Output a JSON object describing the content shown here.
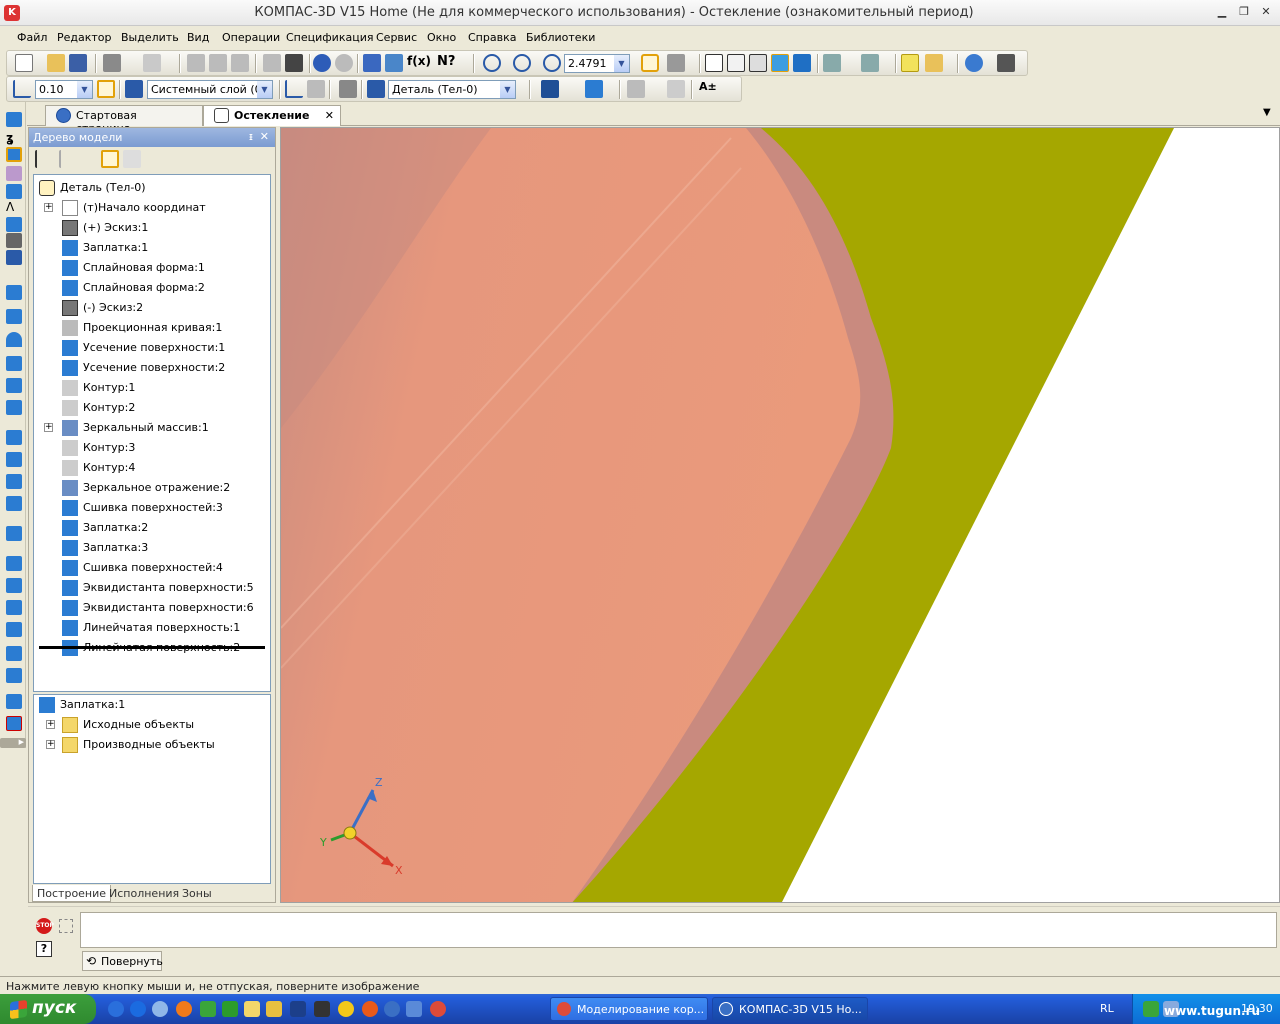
{
  "window": {
    "title": "КОМПАС-3D V15 Home (Не для коммерческого использования) - Остекление (ознакомительный период)"
  },
  "menu": [
    "Файл",
    "Редактор",
    "Выделить",
    "Вид",
    "Операции",
    "Спецификация",
    "Сервис",
    "Окно",
    "Справка",
    "Библиотеки"
  ],
  "toolbar": {
    "zoom": "2.4791",
    "step": "0.10",
    "layer": "Системный слой (0)",
    "part": "Деталь (Тел-0)"
  },
  "doc_tabs": {
    "start": "Стартовая страница",
    "active": "Остекление"
  },
  "tree": {
    "title": "Дерево модели",
    "root": "Деталь (Тел-0)",
    "items": [
      "(т)Начало координат",
      "(+) Эскиз:1",
      "Заплатка:1",
      "Сплайновая форма:1",
      "Сплайновая форма:2",
      "(-) Эскиз:2",
      "Проекционная кривая:1",
      "Усечение поверхности:1",
      "Усечение поверхности:2",
      "Контур:1",
      "Контур:2",
      "Зеркальный массив:1",
      "Контур:3",
      "Контур:4",
      "Зеркальное отражение:2",
      "Сшивка поверхностей:3",
      "Заплатка:2",
      "Заплатка:3",
      "Сшивка поверхностей:4",
      "Эквидистанта поверхности:5",
      "Эквидистанта поверхности:6",
      "Линейчатая поверхность:1",
      "Линейчатая поверхность:2"
    ],
    "sub_root": "Заплатка:1",
    "sub_items": [
      "Исходные объекты",
      "Производные объекты"
    ],
    "bottom_tabs": [
      "Построение",
      "Исполнения",
      "Зоны"
    ]
  },
  "axes": {
    "x": "X",
    "y": "Y",
    "z": "Z"
  },
  "command": {
    "rotate": "Повернуть"
  },
  "status": "Нажмите левую кнопку мыши и, не отпуская, поверните изображение",
  "taskbar": {
    "start": "пуск",
    "tasks": [
      "Моделирование кор...",
      "КОМПАС-3D V15 Ho..."
    ],
    "lang": "RL",
    "time": "19:30"
  },
  "watermark": "www.tugun.ru",
  "colors": {
    "salmon": "#e9977a",
    "olive": "#a5a700",
    "bg": "#ece9d8"
  }
}
